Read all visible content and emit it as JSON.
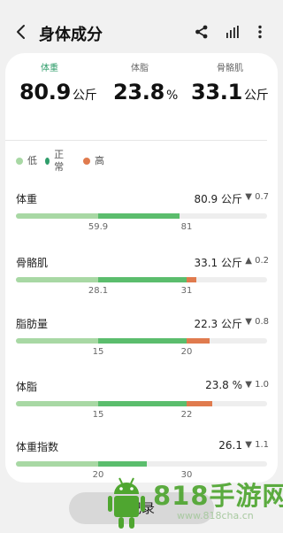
{
  "header": {
    "title": "身体成分",
    "back_icon": "back-arrow-icon",
    "share_icon": "share-icon",
    "stats_icon": "bar-chart-icon",
    "more_icon": "more-vertical-icon"
  },
  "summary": [
    {
      "label": "体重",
      "value": "80.9",
      "unit": "公斤",
      "active": true
    },
    {
      "label": "体脂",
      "value": "23.8",
      "unit": "%",
      "active": false
    },
    {
      "label": "骨骼肌",
      "value": "33.1",
      "unit": "公斤",
      "active": false
    }
  ],
  "legend": [
    {
      "label": "低",
      "color": "#a8d8a4"
    },
    {
      "label": "正常",
      "color": "#2f9d6a"
    },
    {
      "label": "高",
      "color": "#e07b4e"
    }
  ],
  "rows": [
    {
      "label": "体重",
      "value": "80.9 公斤",
      "change": "▼ 0.7",
      "ticks": [
        "59.9",
        "81"
      ],
      "level": 0.65
    },
    {
      "label": "骨骼肌",
      "value": "33.1 公斤",
      "change": "▲ 0.2",
      "ticks": [
        "28.1",
        "31"
      ],
      "level": 0.72
    },
    {
      "label": "脂肪量",
      "value": "22.3 公斤",
      "change": "▼ 0.8",
      "ticks": [
        "15",
        "20"
      ],
      "level": 0.77
    },
    {
      "label": "体脂",
      "value": "23.8 %",
      "change": "▼ 1.0",
      "ticks": [
        "15",
        "22"
      ],
      "level": 0.78
    },
    {
      "label": "体重指数",
      "value": "26.1",
      "change": "▼ 1.1",
      "ticks": [
        "20",
        "30"
      ],
      "level": 0.52
    }
  ],
  "record_button": "记录",
  "watermark": {
    "text": "818手游网",
    "url": "www.818cha.cn"
  }
}
